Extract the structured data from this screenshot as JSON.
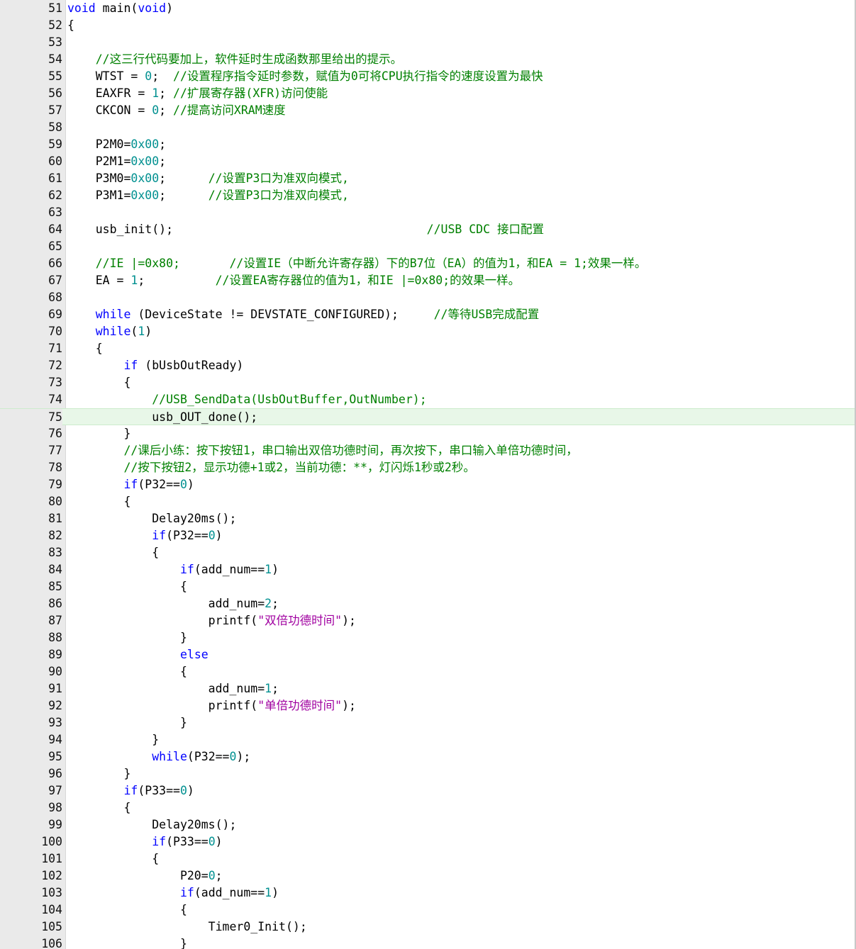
{
  "editor": {
    "colors": {
      "keyword": "#0000ff",
      "number": "#009090",
      "string": "#a000a0",
      "comment": "#008000",
      "plain": "#000000",
      "gutter_bg": "#eaeaea",
      "current_line_bg": "#e8f7e8"
    },
    "current_line": 75,
    "lines": [
      {
        "n": "51",
        "t": [
          [
            "kw",
            "void"
          ],
          [
            "p",
            " main("
          ],
          [
            "kw",
            "void"
          ],
          [
            "p",
            ")"
          ]
        ]
      },
      {
        "n": "52",
        "t": [
          [
            "p",
            "{"
          ]
        ]
      },
      {
        "n": "53",
        "t": []
      },
      {
        "n": "54",
        "t": [
          [
            "p",
            "    "
          ],
          [
            "cm",
            "//这三行代码要加上，软件延时生成函数那里给出的提示。"
          ]
        ]
      },
      {
        "n": "55",
        "t": [
          [
            "p",
            "    WTST = "
          ],
          [
            "num",
            "0"
          ],
          [
            "p",
            ";  "
          ],
          [
            "cm",
            "//设置程序指令延时参数，赋值为0可将CPU执行指令的速度设置为最快"
          ]
        ]
      },
      {
        "n": "56",
        "t": [
          [
            "p",
            "    EAXFR = "
          ],
          [
            "num",
            "1"
          ],
          [
            "p",
            "; "
          ],
          [
            "cm",
            "//扩展寄存器(XFR)访问使能"
          ]
        ]
      },
      {
        "n": "57",
        "t": [
          [
            "p",
            "    CKCON = "
          ],
          [
            "num",
            "0"
          ],
          [
            "p",
            "; "
          ],
          [
            "cm",
            "//提高访问XRAM速度"
          ]
        ]
      },
      {
        "n": "58",
        "t": []
      },
      {
        "n": "59",
        "t": [
          [
            "p",
            "    P2M0="
          ],
          [
            "num",
            "0x00"
          ],
          [
            "p",
            ";"
          ]
        ]
      },
      {
        "n": "60",
        "t": [
          [
            "p",
            "    P2M1="
          ],
          [
            "num",
            "0x00"
          ],
          [
            "p",
            ";"
          ]
        ]
      },
      {
        "n": "61",
        "t": [
          [
            "p",
            "    P3M0="
          ],
          [
            "num",
            "0x00"
          ],
          [
            "p",
            ";      "
          ],
          [
            "cm",
            "//设置P3口为准双向模式,"
          ]
        ]
      },
      {
        "n": "62",
        "t": [
          [
            "p",
            "    P3M1="
          ],
          [
            "num",
            "0x00"
          ],
          [
            "p",
            ";      "
          ],
          [
            "cm",
            "//设置P3口为准双向模式,"
          ]
        ]
      },
      {
        "n": "63",
        "t": []
      },
      {
        "n": "64",
        "t": [
          [
            "p",
            "    usb_init();                                    "
          ],
          [
            "cm",
            "//USB CDC 接口配置"
          ]
        ]
      },
      {
        "n": "65",
        "t": []
      },
      {
        "n": "66",
        "t": [
          [
            "p",
            "    "
          ],
          [
            "cm",
            "//IE |=0x80;       //设置IE（中断允许寄存器）下的B7位（EA）的值为1，和EA = 1;效果一样。"
          ]
        ]
      },
      {
        "n": "67",
        "t": [
          [
            "p",
            "    EA = "
          ],
          [
            "num",
            "1"
          ],
          [
            "p",
            ";          "
          ],
          [
            "cm",
            "//设置EA寄存器位的值为1，和IE |=0x80;的效果一样。"
          ]
        ]
      },
      {
        "n": "68",
        "t": []
      },
      {
        "n": "69",
        "t": [
          [
            "p",
            "    "
          ],
          [
            "kw",
            "while"
          ],
          [
            "p",
            " (DeviceState != DEVSTATE_CONFIGURED);     "
          ],
          [
            "cm",
            "//等待USB完成配置"
          ]
        ]
      },
      {
        "n": "70",
        "t": [
          [
            "p",
            "    "
          ],
          [
            "kw",
            "while"
          ],
          [
            "p",
            "("
          ],
          [
            "num",
            "1"
          ],
          [
            "p",
            ")"
          ]
        ]
      },
      {
        "n": "71",
        "t": [
          [
            "p",
            "    {"
          ]
        ]
      },
      {
        "n": "72",
        "t": [
          [
            "p",
            "        "
          ],
          [
            "kw",
            "if"
          ],
          [
            "p",
            " (bUsbOutReady)"
          ]
        ]
      },
      {
        "n": "73",
        "t": [
          [
            "p",
            "        {"
          ]
        ]
      },
      {
        "n": "74",
        "t": [
          [
            "p",
            "            "
          ],
          [
            "cm",
            "//USB_SendData(UsbOutBuffer,OutNumber);"
          ]
        ]
      },
      {
        "n": "75",
        "t": [
          [
            "p",
            "            usb_OUT_done();"
          ]
        ]
      },
      {
        "n": "76",
        "t": [
          [
            "p",
            "        }"
          ]
        ]
      },
      {
        "n": "77",
        "t": [
          [
            "p",
            "        "
          ],
          [
            "cm",
            "//课后小练：按下按钮1，串口输出双倍功德时间，再次按下，串口输入单倍功德时间，"
          ]
        ]
      },
      {
        "n": "78",
        "t": [
          [
            "p",
            "        "
          ],
          [
            "cm",
            "//按下按钮2，显示功德+1或2，当前功德：**，灯闪烁1秒或2秒。"
          ]
        ]
      },
      {
        "n": "79",
        "t": [
          [
            "p",
            "        "
          ],
          [
            "kw",
            "if"
          ],
          [
            "p",
            "(P32=="
          ],
          [
            "num",
            "0"
          ],
          [
            "p",
            ")"
          ]
        ]
      },
      {
        "n": "80",
        "t": [
          [
            "p",
            "        {"
          ]
        ]
      },
      {
        "n": "81",
        "t": [
          [
            "p",
            "            Delay20ms();"
          ]
        ]
      },
      {
        "n": "82",
        "t": [
          [
            "p",
            "            "
          ],
          [
            "kw",
            "if"
          ],
          [
            "p",
            "(P32=="
          ],
          [
            "num",
            "0"
          ],
          [
            "p",
            ")"
          ]
        ]
      },
      {
        "n": "83",
        "t": [
          [
            "p",
            "            {"
          ]
        ]
      },
      {
        "n": "84",
        "t": [
          [
            "p",
            "                "
          ],
          [
            "kw",
            "if"
          ],
          [
            "p",
            "(add_num=="
          ],
          [
            "num",
            "1"
          ],
          [
            "p",
            ")"
          ]
        ]
      },
      {
        "n": "85",
        "t": [
          [
            "p",
            "                {"
          ]
        ]
      },
      {
        "n": "86",
        "t": [
          [
            "p",
            "                    add_num="
          ],
          [
            "num",
            "2"
          ],
          [
            "p",
            ";"
          ]
        ]
      },
      {
        "n": "87",
        "t": [
          [
            "p",
            "                    printf("
          ],
          [
            "str",
            "\"双倍功德时间\""
          ],
          [
            "p",
            ");"
          ]
        ]
      },
      {
        "n": "88",
        "t": [
          [
            "p",
            "                }"
          ]
        ]
      },
      {
        "n": "89",
        "t": [
          [
            "p",
            "                "
          ],
          [
            "kw",
            "else"
          ]
        ]
      },
      {
        "n": "90",
        "t": [
          [
            "p",
            "                {"
          ]
        ]
      },
      {
        "n": "91",
        "t": [
          [
            "p",
            "                    add_num="
          ],
          [
            "num",
            "1"
          ],
          [
            "p",
            ";"
          ]
        ]
      },
      {
        "n": "92",
        "t": [
          [
            "p",
            "                    printf("
          ],
          [
            "str",
            "\"单倍功德时间\""
          ],
          [
            "p",
            ");"
          ]
        ]
      },
      {
        "n": "93",
        "t": [
          [
            "p",
            "                }"
          ]
        ]
      },
      {
        "n": "94",
        "t": [
          [
            "p",
            "            }"
          ]
        ]
      },
      {
        "n": "95",
        "t": [
          [
            "p",
            "            "
          ],
          [
            "kw",
            "while"
          ],
          [
            "p",
            "(P32=="
          ],
          [
            "num",
            "0"
          ],
          [
            "p",
            ");"
          ]
        ]
      },
      {
        "n": "96",
        "t": [
          [
            "p",
            "        }"
          ]
        ]
      },
      {
        "n": "97",
        "t": [
          [
            "p",
            "        "
          ],
          [
            "kw",
            "if"
          ],
          [
            "p",
            "(P33=="
          ],
          [
            "num",
            "0"
          ],
          [
            "p",
            ")"
          ]
        ]
      },
      {
        "n": "98",
        "t": [
          [
            "p",
            "        {"
          ]
        ]
      },
      {
        "n": "99",
        "t": [
          [
            "p",
            "            Delay20ms();"
          ]
        ]
      },
      {
        "n": "100",
        "t": [
          [
            "p",
            "            "
          ],
          [
            "kw",
            "if"
          ],
          [
            "p",
            "(P33=="
          ],
          [
            "num",
            "0"
          ],
          [
            "p",
            ")"
          ]
        ]
      },
      {
        "n": "101",
        "t": [
          [
            "p",
            "            {"
          ]
        ]
      },
      {
        "n": "102",
        "t": [
          [
            "p",
            "                P20="
          ],
          [
            "num",
            "0"
          ],
          [
            "p",
            ";"
          ]
        ]
      },
      {
        "n": "103",
        "t": [
          [
            "p",
            "                "
          ],
          [
            "kw",
            "if"
          ],
          [
            "p",
            "(add_num=="
          ],
          [
            "num",
            "1"
          ],
          [
            "p",
            ")"
          ]
        ]
      },
      {
        "n": "104",
        "t": [
          [
            "p",
            "                {"
          ]
        ]
      },
      {
        "n": "105",
        "t": [
          [
            "p",
            "                    Timer0_Init();"
          ]
        ]
      },
      {
        "n": "106",
        "t": [
          [
            "p",
            "                }"
          ]
        ]
      }
    ]
  }
}
